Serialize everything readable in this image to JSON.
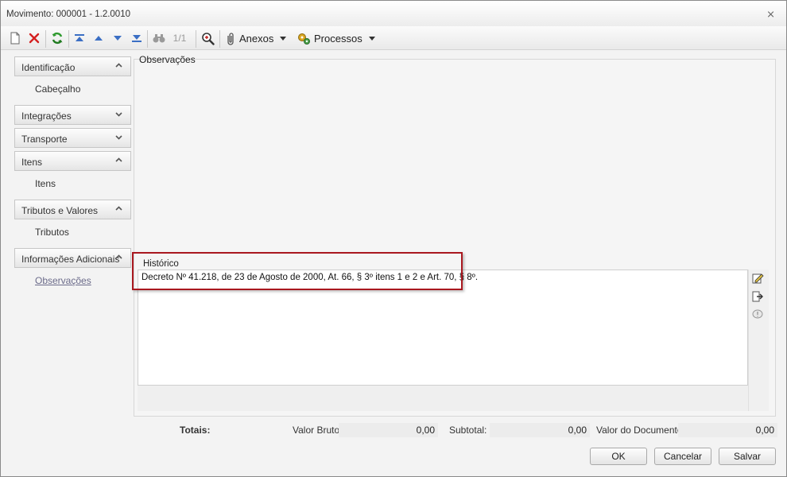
{
  "window": {
    "title": "Movimento: 000001 - 1.2.0010",
    "close_glyph": "⨯"
  },
  "toolbar": {
    "pager": "1/1",
    "anexos_label": "Anexos",
    "processos_label": "Processos"
  },
  "sidebar": {
    "groups": [
      {
        "label": "Identificação",
        "expanded": true,
        "items": [
          "Cabeçalho"
        ]
      },
      {
        "label": "Integrações",
        "expanded": false,
        "items": []
      },
      {
        "label": "Transporte",
        "expanded": false,
        "items": []
      },
      {
        "label": "Itens",
        "expanded": true,
        "items": [
          "Itens"
        ]
      },
      {
        "label": "Tributos e Valores",
        "expanded": true,
        "items": [
          "Tributos"
        ]
      },
      {
        "label": "Informações Adicionais",
        "expanded": true,
        "items": [
          "Observações"
        ]
      }
    ]
  },
  "main": {
    "section_label": "Observações",
    "historico_label": "Histórico",
    "historico_text": "Decreto Nº 41.218, de 23 de Agosto de 2000, At. 66, § 3º itens 1 e 2 e Art. 70, § 8º."
  },
  "totals": {
    "label": "Totais:",
    "valor_bruto_label": "Valor Bruto:",
    "valor_bruto": "0,00",
    "subtotal_label": "Subtotal: :",
    "subtotal": "0,00",
    "valor_documento_label": "Valor do Documento:",
    "valor_documento": "0,00"
  },
  "buttons": {
    "ok": "OK",
    "cancel": "Cancelar",
    "save": "Salvar"
  },
  "colors": {
    "highlight": "#a9181f",
    "accent_blue": "#3b6fc4",
    "delete_red": "#d42020",
    "refresh_green": "#2e9a2e"
  }
}
